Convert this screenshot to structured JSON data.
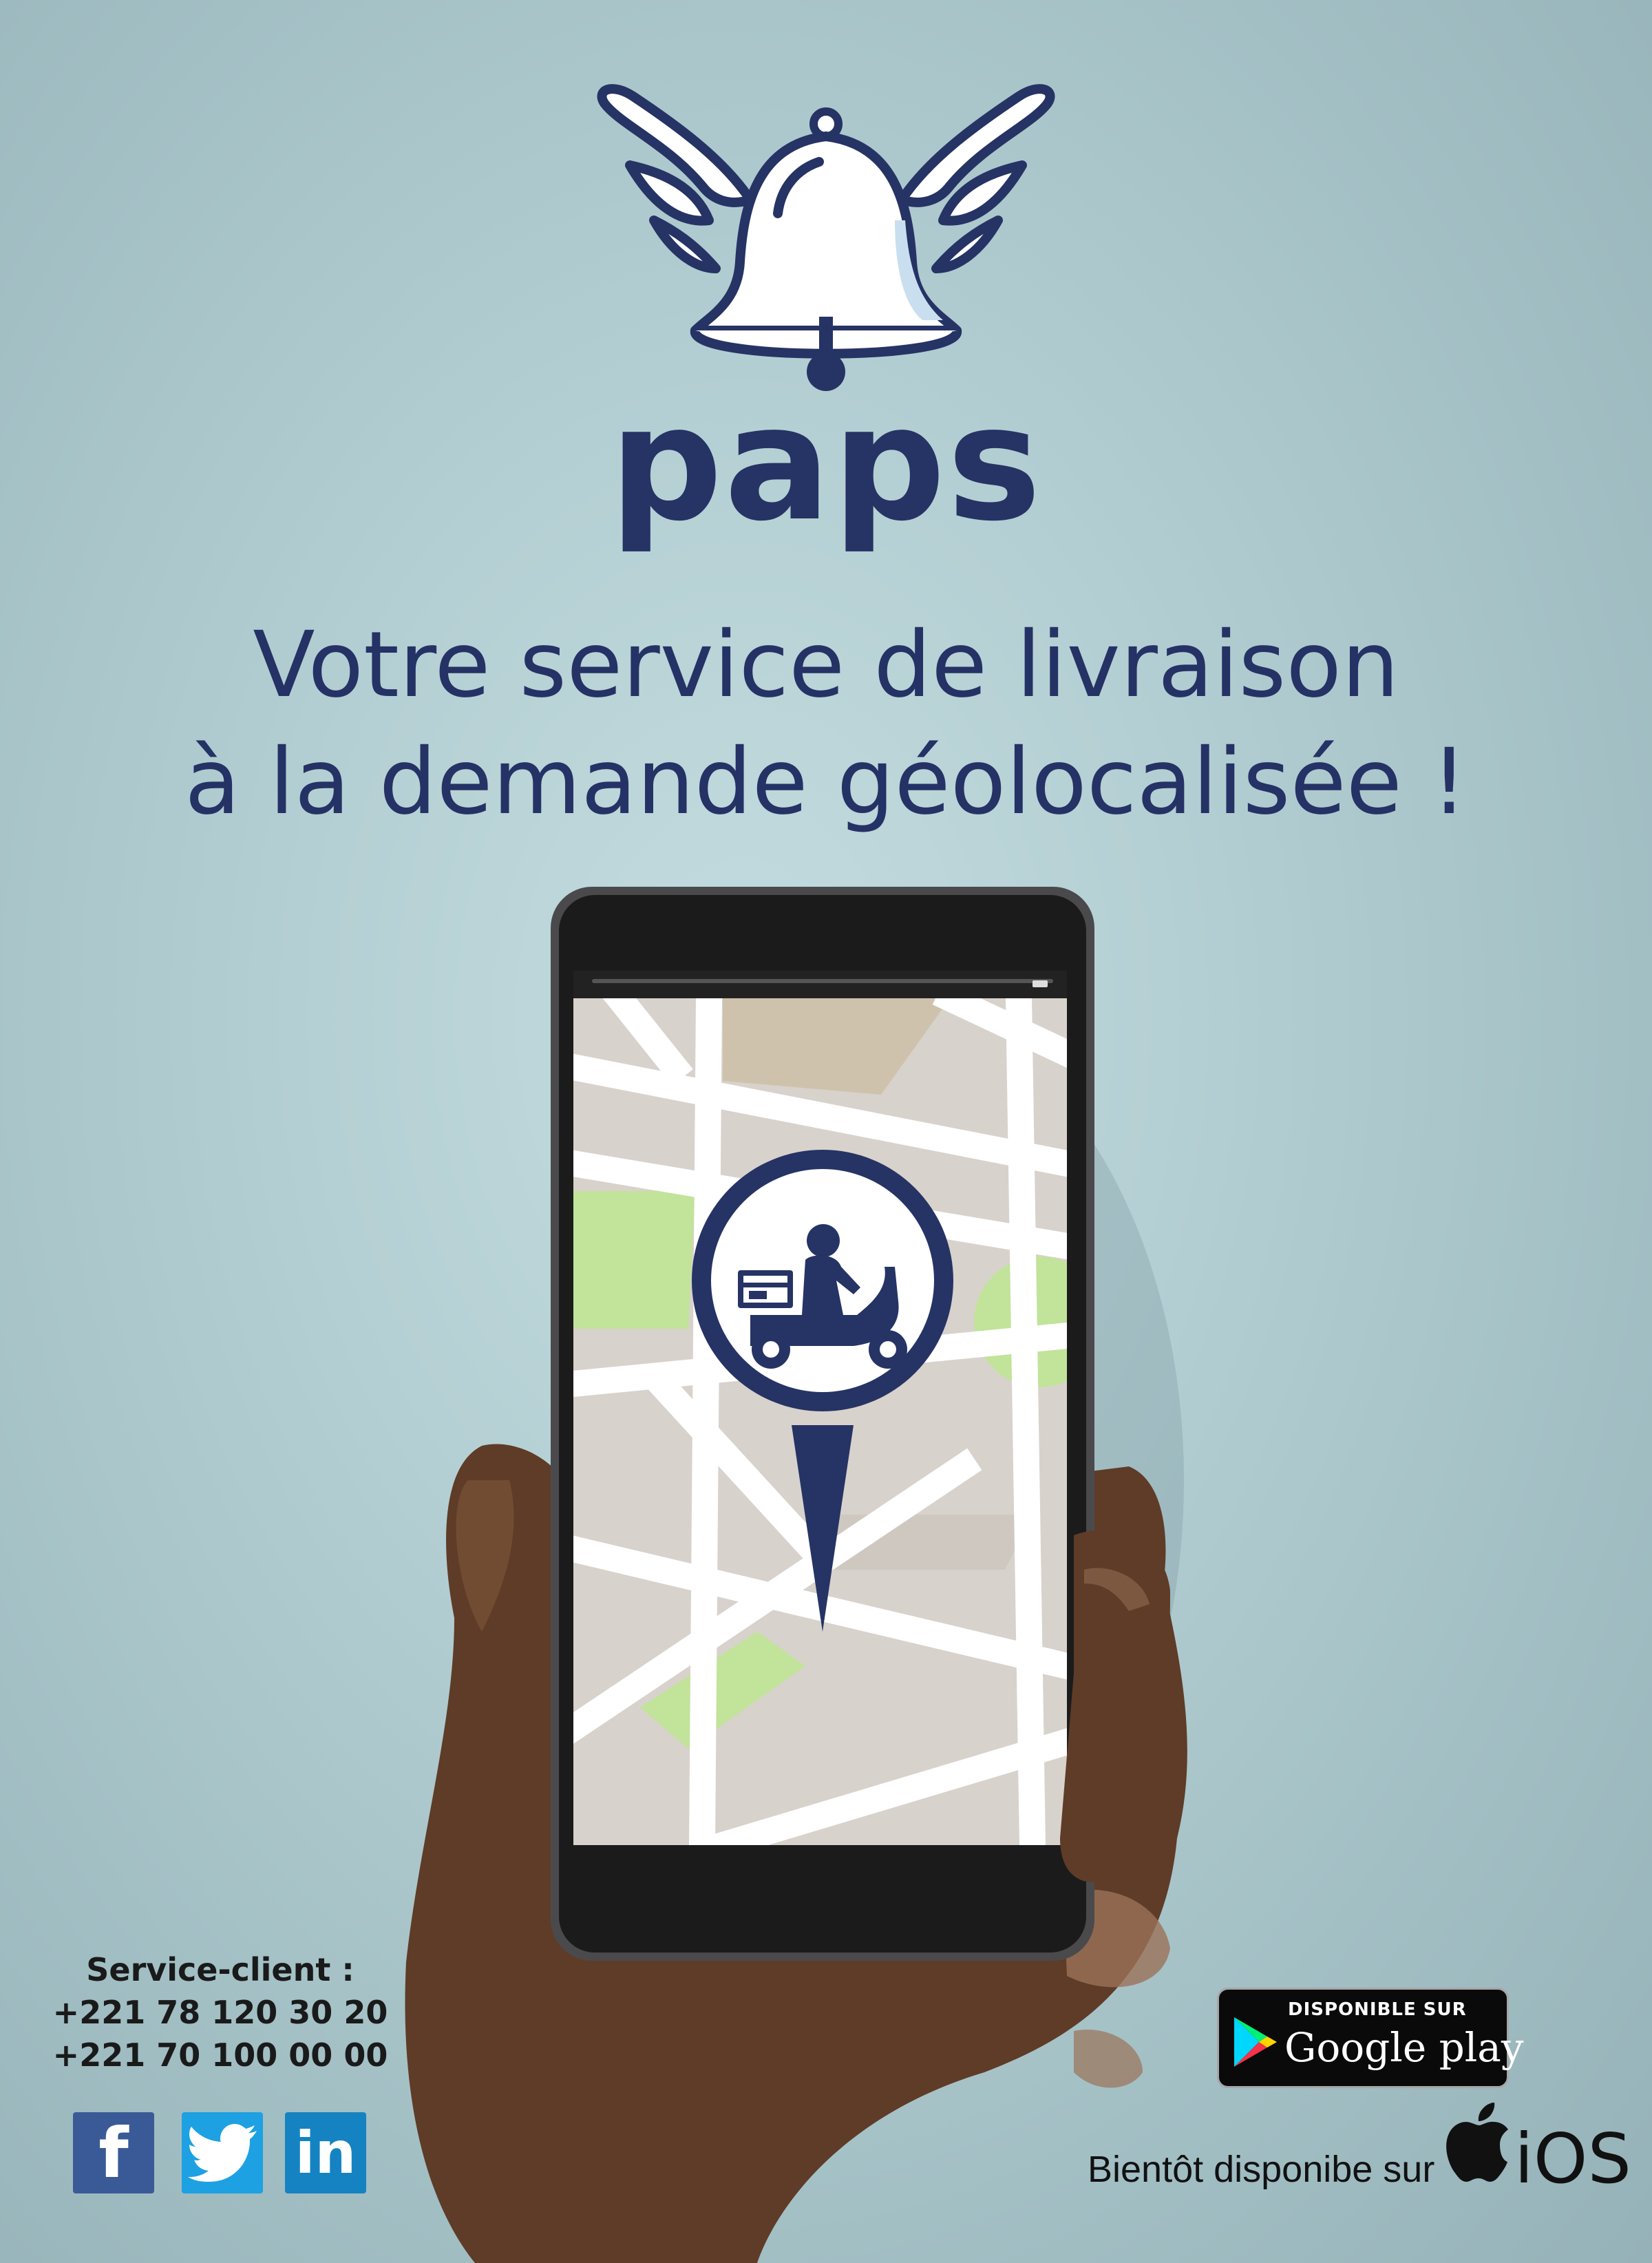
{
  "brand": {
    "name": "paps",
    "logo_icon": "winged-bell-icon"
  },
  "headline": {
    "line1": "Votre service de livraison",
    "line2": "à la demande géolocalisée !"
  },
  "contact": {
    "title": "Service-client :",
    "phone1": "+221 78 120 30 20",
    "phone2": "+221 70 100 00 00"
  },
  "social": {
    "facebook": "f",
    "linkedin": "in",
    "twitter_icon": "twitter-bird-icon"
  },
  "store": {
    "google_small": "DISPONIBLE SUR",
    "google_large": "Google play",
    "ios_text": "Bientôt disponibe sur",
    "ios_label": "iOS"
  },
  "colors": {
    "brand_navy": "#263365",
    "map_green": "#c2e39a",
    "background": "#b4cfd3"
  }
}
